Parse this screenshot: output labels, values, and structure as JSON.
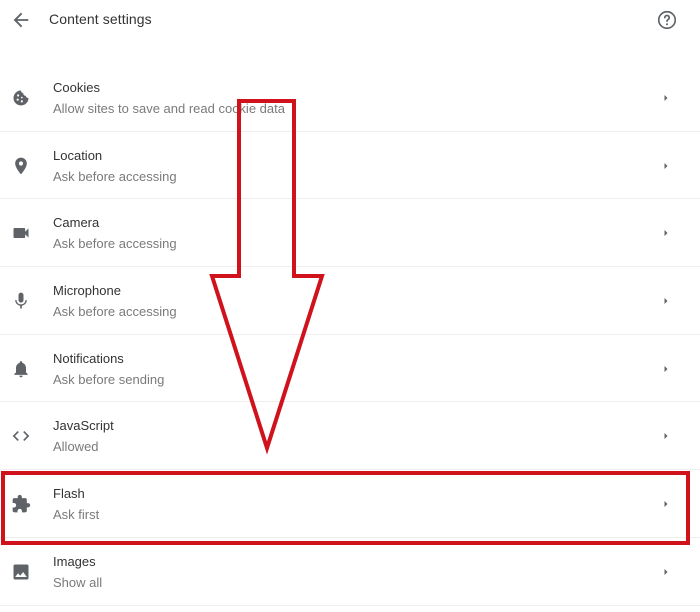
{
  "header": {
    "title": "Content settings",
    "back_icon": "arrow-back-icon",
    "help_icon": "help-icon"
  },
  "rows": [
    {
      "title": "Cookies",
      "subtitle": "Allow sites to save and read cookie data",
      "icon": "cookie-icon"
    },
    {
      "title": "Location",
      "subtitle": "Ask before accessing",
      "icon": "location-pin-icon"
    },
    {
      "title": "Camera",
      "subtitle": "Ask before accessing",
      "icon": "camera-icon"
    },
    {
      "title": "Microphone",
      "subtitle": "Ask before accessing",
      "icon": "microphone-icon"
    },
    {
      "title": "Notifications",
      "subtitle": "Ask before sending",
      "icon": "bell-icon"
    },
    {
      "title": "JavaScript",
      "subtitle": "Allowed",
      "icon": "code-icon"
    },
    {
      "title": "Flash",
      "subtitle": "Ask first",
      "icon": "puzzle-icon"
    },
    {
      "title": "Images",
      "subtitle": "Show all",
      "icon": "image-icon"
    }
  ],
  "annotation": {
    "color": "#d0121c",
    "highlighted_row": "Flash",
    "arrow_icon": "down-arrow-annotation"
  }
}
